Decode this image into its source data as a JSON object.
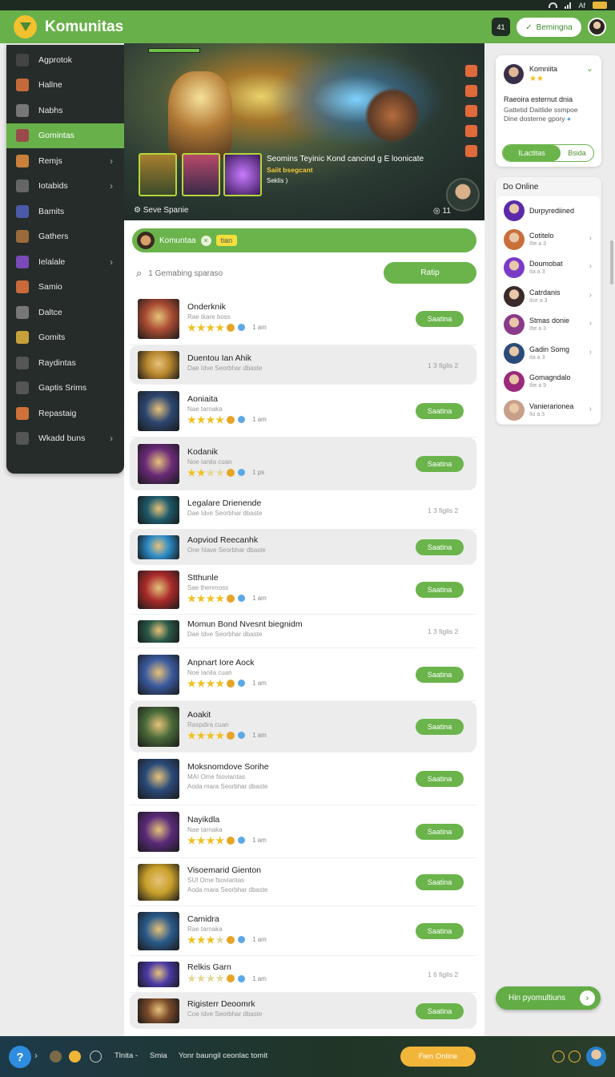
{
  "app": {
    "title": "Komunitas"
  },
  "header": {
    "notif_count": "41",
    "action_label": "Bemingna"
  },
  "sidebar": {
    "items": [
      {
        "label": "Agprotok",
        "icon": "search-icon",
        "chevron": false,
        "active": false,
        "color": "#444"
      },
      {
        "label": "Hallne",
        "icon": "hero-icon",
        "chevron": false,
        "active": false,
        "color": "#c46a3a"
      },
      {
        "label": "Nabhs",
        "icon": "shield-icon",
        "chevron": false,
        "active": false,
        "color": "#777"
      },
      {
        "label": "Gomintas",
        "icon": "hero-icon",
        "chevron": false,
        "active": true,
        "color": "#9a4a4a"
      },
      {
        "label": "Remjs",
        "icon": "sword-icon",
        "chevron": true,
        "active": false,
        "color": "#c8803a"
      },
      {
        "label": "Iotabids",
        "icon": "map-icon",
        "chevron": true,
        "active": false,
        "color": "#666"
      },
      {
        "label": "Bamits",
        "icon": "hero-icon",
        "chevron": false,
        "active": false,
        "color": "#4a5aa8"
      },
      {
        "label": "Gathers",
        "icon": "hero-icon",
        "chevron": false,
        "active": false,
        "color": "#9a6a3a"
      },
      {
        "label": "Ielalale",
        "icon": "magic-icon",
        "chevron": true,
        "active": false,
        "color": "#7a4ab8"
      },
      {
        "label": "Samio",
        "icon": "sword-icon",
        "chevron": false,
        "active": false,
        "color": "#c86a3a"
      },
      {
        "label": "Daltce",
        "icon": "hero-icon",
        "chevron": false,
        "active": false,
        "color": "#777"
      },
      {
        "label": "Gomits",
        "icon": "sword-icon",
        "chevron": false,
        "active": false,
        "color": "#c8a03a"
      },
      {
        "label": "Raydintas",
        "icon": "globe-icon",
        "chevron": false,
        "active": false,
        "color": "#555"
      },
      {
        "label": "Gaptis Srims",
        "icon": "clock-icon",
        "chevron": false,
        "active": false,
        "color": "#555"
      },
      {
        "label": "Repastaig",
        "icon": "sword-icon",
        "chevron": false,
        "active": false,
        "color": "#d0703a"
      },
      {
        "label": "Wkadd buns",
        "icon": "heart-icon",
        "chevron": true,
        "active": false,
        "color": "#555"
      }
    ]
  },
  "banner": {
    "title": "Seomins Teyinic Kond cancind g E loonicate",
    "subtitle": "Saiit bsegcant",
    "detail": "Seklis )",
    "footer_label": "Seve Spanie",
    "count": "11"
  },
  "filter": {
    "chip_label": "Komuntaa",
    "tag_label": "tian"
  },
  "search": {
    "placeholder": "1 Gemabing sparaso",
    "button_label": "Ratip"
  },
  "list": [
    {
      "title": "Onderknik",
      "desc": "Rae tkare boss",
      "stars": 4,
      "count": "1 am",
      "kind": "button",
      "action": "Saatina",
      "thumb": "#a84a32",
      "hl": false
    },
    {
      "title": "Duentou Ian Ahik",
      "desc": "Dae Idve Seorbhar dbaste",
      "kind": "meta",
      "meta": "1 3 figlis 2",
      "thumb": "#b8862e",
      "hl": true
    },
    {
      "title": "Aoniaita",
      "desc": "Nae tarnaka",
      "stars": 4,
      "count": "1 am",
      "kind": "button",
      "action": "Saatina",
      "thumb": "#2c4670",
      "hl": false
    },
    {
      "title": "Kodanik",
      "desc": "Noe Ianila cuan",
      "stars": 2,
      "count": "1 ps",
      "kind": "button",
      "action": "Saatina",
      "thumb": "#6a2a78",
      "hl": true
    },
    {
      "title": "Legalare Drienende",
      "desc": "Dae Idve Seorbhar dbaste",
      "kind": "meta",
      "meta": "1 3 figlis 2",
      "thumb": "#1c5a6a",
      "hl": false
    },
    {
      "title": "Aopviod Reecanhk",
      "desc": "One hlave Seorbhar dbaste",
      "kind": "button",
      "action": "Saatina",
      "thumb": "#2a8ac8",
      "hl": true
    },
    {
      "title": "Stthunle",
      "desc": "Sae thenmoss",
      "stars": 4,
      "count": "1 am",
      "kind": "button",
      "action": "Saatina",
      "thumb": "#a82a2a",
      "hl": false
    },
    {
      "title": "Momun Bond Nvesnt biegnidm",
      "desc": "Dae Idve Seorbhar dbaste",
      "kind": "meta",
      "meta": "1 3 figlis 2",
      "thumb": "#2a5a4a",
      "hl": false
    },
    {
      "title": "Anpnart Iore Aock",
      "desc": "Noe Ianila cuan",
      "stars": 4,
      "count": "1 am",
      "kind": "button",
      "action": "Saatina",
      "thumb": "#3a5aa0",
      "hl": false
    },
    {
      "title": "Aoakit",
      "desc": "Raspdira cuan",
      "stars": 4,
      "count": "1 am",
      "kind": "button",
      "action": "Saatina",
      "thumb": "#4a6a3a",
      "hl": true
    },
    {
      "title": "Moksnomdove Sorihe",
      "desc": "MAI Ome fsoviantas",
      "desc2": "Aoda mara Seorbhar dbaste",
      "kind": "button",
      "action": "Saatina",
      "thumb": "#2a4a7a",
      "hl": false
    },
    {
      "title": "Nayikdla",
      "desc": "Nae tarnaka",
      "stars": 4,
      "count": "1 am",
      "kind": "button",
      "action": "Saatina",
      "thumb": "#5a2a7a",
      "hl": false
    },
    {
      "title": "Visoemarid Gienton",
      "desc": "SUI Ome fsoviantas",
      "desc2": "Aoda mara Seorbhar dbaste",
      "kind": "button",
      "action": "Saatina",
      "thumb": "#c8a02a",
      "hl": false
    },
    {
      "title": "Camidra",
      "desc": "Rae tarnaka",
      "stars": 3,
      "count": "1 am",
      "kind": "button",
      "action": "Saatina",
      "thumb": "#2a5a8a",
      "hl": false
    },
    {
      "title": "Relkis Garn",
      "desc": "",
      "stars": 0,
      "count": "1 am",
      "kind": "meta",
      "meta": "1 6 figlis 2",
      "thumb": "#4a3aa8",
      "hl": false
    },
    {
      "title": "Rigisterr Deoomrk",
      "desc": "Coe Idve Seorbhar dbaste",
      "kind": "button",
      "action": "Saatina",
      "thumb": "#7a4a2a",
      "hl": true
    }
  ],
  "profile_card": {
    "name": "Komniita",
    "stars": "★★",
    "heading": "Raeoira esternut dnia",
    "line1": "Gattetid Daitlide ssmpoe",
    "line2": "Dine dosterne gpory",
    "toggle_on": "ILactitas",
    "toggle_off": "Bsida"
  },
  "online": {
    "heading": "Do Online",
    "users": [
      {
        "name": "Durpyrediined",
        "sub": "",
        "chevron": false,
        "color": "#5a2aa8"
      },
      {
        "name": "Cotitelo",
        "sub": "Ilte a 3",
        "chevron": true,
        "color": "#c8703a"
      },
      {
        "name": "Doumobat",
        "sub": "Ita a 3",
        "chevron": true,
        "color": "#7a3ac8"
      },
      {
        "name": "Catrdanis",
        "sub": "Ilce a 3",
        "chevron": true,
        "color": "#3a2a2a"
      },
      {
        "name": "Stmas donie",
        "sub": "Ilte a 3",
        "chevron": true,
        "color": "#8a3a8a"
      },
      {
        "name": "Gadin Somg",
        "sub": "Ita a 3",
        "chevron": true,
        "color": "#2a4a7a"
      },
      {
        "name": "Gomagndalo",
        "sub": "Ilte a 9",
        "chevron": false,
        "color": "#9a2a7a"
      },
      {
        "name": "Vanierarionea",
        "sub": "Ilo a 3",
        "chevron": true,
        "color": "#c8a08a"
      }
    ]
  },
  "fab": {
    "label": "Hin pyomultiuns"
  },
  "bottombar": {
    "help": "?",
    "t1": "Tlnita -",
    "t2": "Smia",
    "t3": "Yonr baungil ceonlac tomit",
    "cta": "Fien Online"
  },
  "colors": {
    "brand": "#68b14a",
    "dark": "#252c29",
    "star": "#f0c020"
  }
}
